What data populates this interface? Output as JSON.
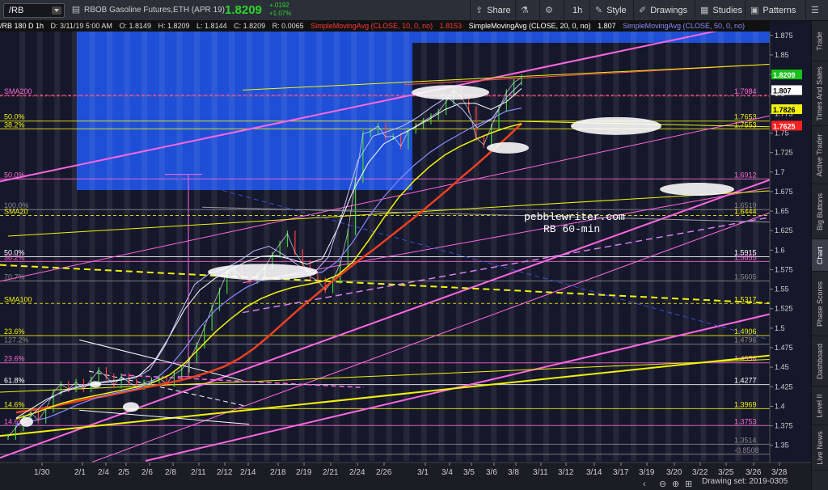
{
  "toolbar": {
    "symbol": "/RB",
    "description": "RBOB Gasoline Futures,ETH (APR 19)",
    "last": "1.8209",
    "change_abs": "+.0192",
    "change_pct": "+1.07%",
    "buttons": {
      "share": "Share",
      "timeframe": "1h",
      "style": "Style",
      "drawings": "Drawings",
      "studies": "Studies",
      "patterns": "Patterns"
    }
  },
  "infobar": {
    "header": "/RB 180 D 1h",
    "date": "D: 3/11/19 5:00 AM",
    "open": "O: 1.8149",
    "high": "H: 1.8209",
    "low": "L: 1.8144",
    "close": "C: 1.8209",
    "range": "R: 0.0065",
    "sma10": "SimpleMovingAvg (CLOSE, 10, 0, no)",
    "sma10_val": "1.8153",
    "sma20": "SimpleMovingAvg (CLOSE, 20, 0, no)",
    "sma20_val": "1.807",
    "sma50": "SimpleMovingAvg (CLOSE, 50, 0, no)",
    "colors": {
      "red": "#ff3b3b",
      "white": "#ffffff",
      "blue": "#7b7bff"
    }
  },
  "sidebar": {
    "tabs": [
      "Trade",
      "Times And Sales",
      "Active Trader",
      "Big Buttons",
      "Chart",
      "Phase Scores",
      "Dashboard",
      "Level II",
      "Live News"
    ],
    "active": "Chart"
  },
  "drawing_set": "Drawing set: 2019-0305",
  "chart_data": {
    "type": "line",
    "ylim": [
      1.33,
      1.88
    ],
    "y_ticks": [
      "1.875",
      "1.85",
      "1.825",
      "1.8",
      "1.775",
      "1.75",
      "1.725",
      "1.7",
      "1.675",
      "1.65",
      "1.625",
      "1.6",
      "1.575",
      "1.55",
      "1.525",
      "1.5",
      "1.475",
      "1.45",
      "1.425",
      "1.4",
      "1.375",
      "1.35"
    ],
    "x_labels": [
      "1/30",
      "2/1",
      "2/4",
      "2/5",
      "2/6",
      "2/8",
      "2/11",
      "2/12",
      "2/14",
      "2/18",
      "2/19",
      "2/21",
      "2/24",
      "2/26",
      "3/1",
      "3/4",
      "3/5",
      "3/6",
      "3/8",
      "3/11",
      "3/12",
      "3/14",
      "3/17",
      "3/19",
      "3/20",
      "3/22",
      "3/25",
      "3/26",
      "3/28"
    ],
    "price_tags": [
      {
        "label": "1.8209",
        "value": 1.8209,
        "bg": "#19c219",
        "fg": "#ffffff"
      },
      {
        "label": "1.807",
        "value": 1.807,
        "bg": "#ffffff",
        "fg": "#000000"
      },
      {
        "label": "1.7826",
        "value": 1.7826,
        "bg": "#f2f20a",
        "fg": "#000000"
      },
      {
        "label": "1.7625",
        "value": 1.7625,
        "bg": "#ff2020",
        "fg": "#ffffff"
      }
    ],
    "fib_levels": [
      {
        "left": "SMA200",
        "right": "1.7984",
        "value": 1.7984,
        "color": "#ff6ad5"
      },
      {
        "left": "50.0%",
        "right": "1.7653",
        "value": 1.7653,
        "color": "#f2f20a"
      },
      {
        "left": "38.2%",
        "right": "1.7553",
        "value": 1.7553,
        "color": "#f2f20a"
      },
      {
        "left": "50.0%",
        "right": "1.6912",
        "value": 1.6912,
        "color": "#ff6ad5"
      },
      {
        "left": "100.0%",
        "right": "1.6519",
        "value": 1.6519,
        "color": "#8a8a8a"
      },
      {
        "left": "SMA20",
        "right": "1.6444",
        "value": 1.6444,
        "color": "#f2f20a"
      },
      {
        "left": "50.0%",
        "right": "1.5915",
        "value": 1.5915,
        "color": "#ffffff"
      },
      {
        "left": "38.2%",
        "right": "1.5855",
        "value": 1.5855,
        "color": "#ff6ad5"
      },
      {
        "left": "70.7%",
        "right": "1.5605",
        "value": 1.5605,
        "color": "#8a8a8a"
      },
      {
        "left": "SMA100",
        "right": "1.5317",
        "value": 1.5317,
        "color": "#f2f20a"
      },
      {
        "left": "23.6%",
        "right": "1.4906",
        "value": 1.4906,
        "color": "#f2f20a"
      },
      {
        "left": "127.2%",
        "right": "1.4796",
        "value": 1.4796,
        "color": "#8a8a8a"
      },
      {
        "left": "23.6%",
        "right": "1.4556",
        "value": 1.4556,
        "color": "#ff6ad5"
      },
      {
        "left": "61.8%",
        "right": "1.4277",
        "value": 1.4277,
        "color": "#ffffff"
      },
      {
        "left": "14.6%",
        "right": "1.3969",
        "value": 1.3969,
        "color": "#f2f20a"
      },
      {
        "left": "14.6%",
        "right": "1.3753",
        "value": 1.3753,
        "color": "#ff6ad5"
      },
      {
        "left": "",
        "right": "1.3514",
        "value": 1.3514,
        "color": "#8a8a8a"
      },
      {
        "left": "",
        "right": "-0.8508",
        "value": 1.3385,
        "color": "#8a8a8a"
      }
    ],
    "watermark": [
      "pebblewriter.com",
      "RB  60-min"
    ],
    "price_series": [
      [
        1.361,
        1.372,
        1.385,
        1.392,
        1.382,
        1.396,
        1.418,
        1.428,
        1.422,
        1.431
      ],
      [
        1.422,
        1.434,
        1.446,
        1.438,
        1.427,
        1.438,
        1.431,
        1.425,
        1.43,
        1.433
      ],
      [
        1.436,
        1.429,
        1.441,
        1.447,
        1.459,
        1.478,
        1.501,
        1.526,
        1.548,
        1.571
      ],
      [
        1.574,
        1.566,
        1.561,
        1.567,
        1.578,
        1.594,
        1.608,
        1.621,
        1.597,
        1.583
      ],
      [
        1.566,
        1.561,
        1.549,
        1.561,
        1.583,
        1.623,
        1.69,
        1.749,
        1.752,
        1.759
      ],
      [
        1.745,
        1.746,
        1.733,
        1.753,
        1.759,
        1.765,
        1.771,
        1.777,
        1.79,
        1.804
      ],
      [
        1.796,
        1.78,
        1.744,
        1.735,
        1.758,
        1.781,
        1.802,
        1.815,
        1.821
      ]
    ],
    "sma10": [
      1.374,
      1.388,
      1.406,
      1.418,
      1.425,
      1.429,
      1.432,
      1.434,
      1.436,
      1.447,
      1.477,
      1.518,
      1.556,
      1.57,
      1.576,
      1.586,
      1.599,
      1.605,
      1.594,
      1.58,
      1.57,
      1.591,
      1.651,
      1.715,
      1.746,
      1.752,
      1.759,
      1.77,
      1.784,
      1.796,
      1.781,
      1.757,
      1.768,
      1.796,
      1.815
    ],
    "sma20": [
      1.385,
      1.397,
      1.409,
      1.418,
      1.424,
      1.428,
      1.431,
      1.434,
      1.439,
      1.457,
      1.489,
      1.524,
      1.549,
      1.564,
      1.575,
      1.585,
      1.592,
      1.593,
      1.588,
      1.582,
      1.589,
      1.628,
      1.676,
      1.712,
      1.736,
      1.747,
      1.757,
      1.768,
      1.78,
      1.788,
      1.788,
      1.78,
      1.79,
      1.807
    ],
    "sma50": [
      1.377,
      1.381,
      1.385,
      1.393,
      1.402,
      1.409,
      1.415,
      1.419,
      1.423,
      1.433,
      1.45,
      1.474,
      1.501,
      1.523,
      1.539,
      1.552,
      1.561,
      1.565,
      1.568,
      1.569,
      1.572,
      1.586,
      1.611,
      1.642,
      1.668,
      1.69,
      1.709,
      1.725,
      1.738,
      1.749,
      1.76,
      1.768,
      1.778,
      1.782
    ],
    "sma100": [
      1.384,
      1.39,
      1.397,
      1.404,
      1.409,
      1.413,
      1.417,
      1.421,
      1.425,
      1.431,
      1.44,
      1.455,
      1.475,
      1.495,
      1.512,
      1.527,
      1.538,
      1.546,
      1.552,
      1.556,
      1.56,
      1.568,
      1.585,
      1.612,
      1.641,
      1.668,
      1.689,
      1.707,
      1.722,
      1.733,
      1.742,
      1.75,
      1.757,
      1.762
    ],
    "sma200": [
      1.392,
      1.395,
      1.398,
      1.402,
      1.406,
      1.41,
      1.413,
      1.417,
      1.421,
      1.425,
      1.429,
      1.433,
      1.438,
      1.444,
      1.451,
      1.461,
      1.474,
      1.49,
      1.507,
      1.524,
      1.54,
      1.556,
      1.571,
      1.586,
      1.6,
      1.615,
      1.63,
      1.645,
      1.661,
      1.677,
      1.694,
      1.71,
      1.727,
      1.744,
      1.762
    ]
  }
}
